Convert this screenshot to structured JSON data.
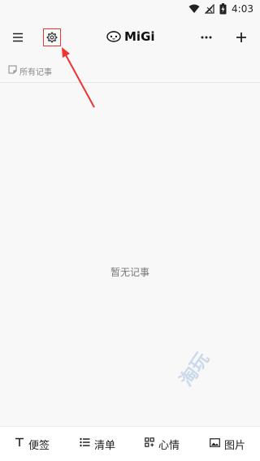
{
  "status_bar": {
    "time": "4:03",
    "icons": [
      "wifi-icon",
      "signal-off-icon",
      "battery-charging-icon"
    ]
  },
  "top_bar": {
    "menu_icon": "menu-icon",
    "settings_icon": "gear-icon",
    "logo_text": "MiGi",
    "more_icon": "more-icon",
    "add_icon": "plus-icon"
  },
  "filter": {
    "label": "所有记事"
  },
  "empty_state": {
    "message": "暂无记事"
  },
  "bottom_tabs": [
    {
      "label": "便签",
      "icon": "text-icon"
    },
    {
      "label": "清单",
      "icon": "list-icon"
    },
    {
      "label": "心情",
      "icon": "mood-icon"
    },
    {
      "label": "图片",
      "icon": "image-icon"
    }
  ],
  "colors": {
    "annotation": "#e33333",
    "background": "#f8f8f8"
  }
}
